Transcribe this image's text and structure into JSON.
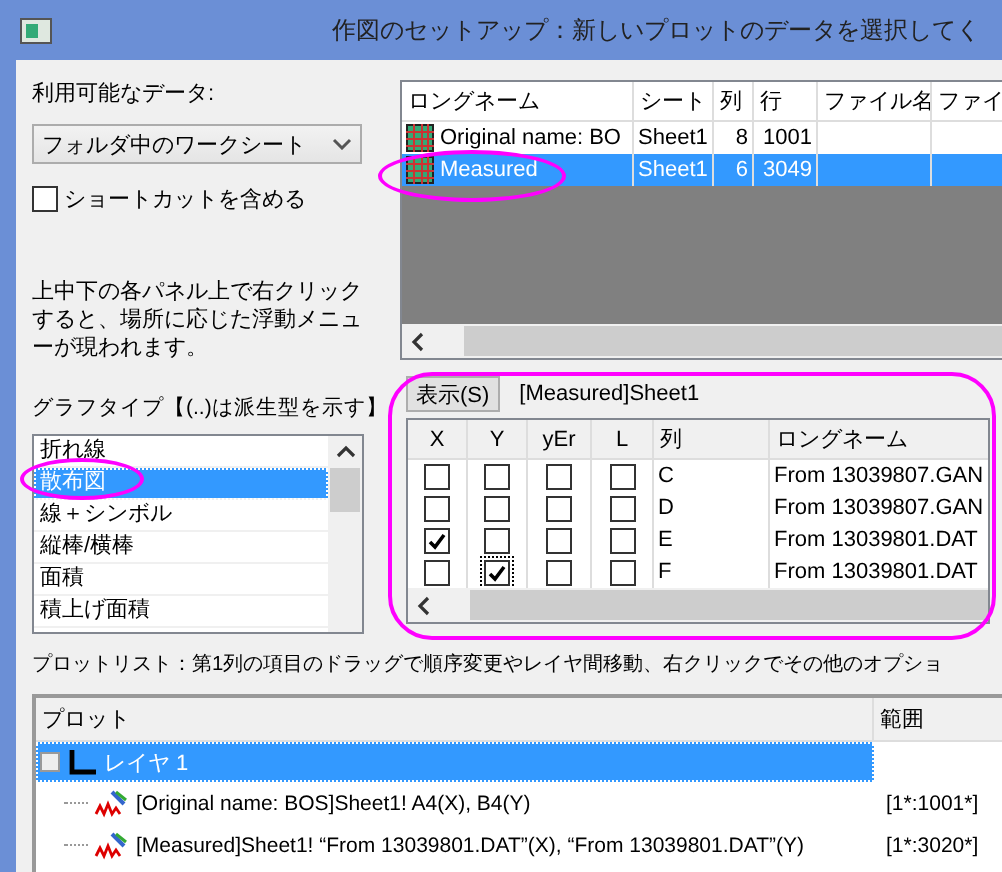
{
  "window": {
    "title": "作図のセットアップ：新しいプロットのデータを選択してく"
  },
  "available_data": {
    "label": "利用可能なデータ:",
    "source": "フォルダ中のワークシート",
    "shortcut": {
      "label": "ショートカットを含める",
      "checked": false
    },
    "help": "上中下の各パネル上で右クリックすると、場所に応じた浮動メニューが現われます。"
  },
  "worksheets": {
    "columns": [
      "ロングネーム",
      "シート",
      "列",
      "行",
      "ファイル名",
      "ファイ"
    ],
    "rows": [
      {
        "long_name": "Original name: BO",
        "sheet": "Sheet1",
        "cols": "8",
        "rows": "1001",
        "selected": false
      },
      {
        "long_name": "Measured",
        "sheet": "Sheet1",
        "cols": "6",
        "rows": "3049",
        "selected": true
      }
    ]
  },
  "graph_types": {
    "label": "グラフタイプ【(..)は派生型を示す】",
    "items": [
      {
        "label": "折れ線",
        "selected": false
      },
      {
        "label": "散布図",
        "selected": true
      },
      {
        "label": "線＋シンボル",
        "selected": false
      },
      {
        "label": "縦棒/横棒",
        "selected": false
      },
      {
        "label": "面積",
        "selected": false
      },
      {
        "label": "積上げ面積",
        "selected": false
      }
    ]
  },
  "columns_panel": {
    "button": "表示(S)",
    "sheet_label": "[Measured]Sheet1",
    "columns": [
      "X",
      "Y",
      "yEr",
      "L",
      "列",
      "ロングネーム"
    ],
    "rows": [
      {
        "x": false,
        "y": false,
        "yer": false,
        "l": false,
        "column": "C",
        "long_name": "From 13039807.GAN"
      },
      {
        "x": false,
        "y": false,
        "yer": false,
        "l": false,
        "column": "D",
        "long_name": "From 13039807.GAN"
      },
      {
        "x": true,
        "y": false,
        "yer": false,
        "l": false,
        "column": "E",
        "long_name": "From 13039801.DAT"
      },
      {
        "x": false,
        "y": true,
        "yer": false,
        "l": false,
        "column": "F",
        "long_name": "From 13039801.DAT"
      }
    ]
  },
  "plot_list": {
    "hint": "プロットリスト：第1列の項目のドラッグで順序変更やレイヤ間移動、右クリックでその他のオプショ",
    "columns": [
      "プロット",
      "範囲"
    ],
    "layers": [
      {
        "label": "レイヤ 1",
        "selected": true,
        "children": [
          {
            "label": "[Original name: BOS]Sheet1!  A4(X), B4(Y)",
            "range": "[1*:1001*]"
          },
          {
            "label": "[Measured]Sheet1!  “From 13039801.DAT”(X), “From 13039801.DAT”(Y)",
            "range": "[1*:3020*]"
          }
        ]
      }
    ]
  }
}
